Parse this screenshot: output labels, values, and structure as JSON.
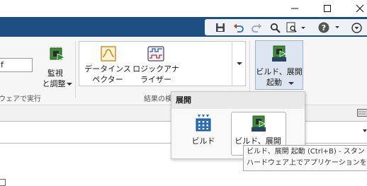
{
  "window": {
    "minimize_icon": "minimize-icon",
    "maximize_icon": "maximize-icon",
    "close_icon": "close-icon"
  },
  "quick_access": {
    "icons": [
      "save-icon",
      "undo-icon",
      "redo-icon",
      "search-icon",
      "search-docs-icon",
      "help-icon",
      "minimize-ribbon-icon"
    ]
  },
  "ribbon": {
    "field_value": "f",
    "monitor_label_line1": "監視",
    "monitor_label_line2": "と調整",
    "run_group_label": "ウェアで実行",
    "gallery": {
      "items": [
        {
          "line1": "データインス",
          "line2": "ペクター"
        },
        {
          "line1": "ロジックアナ",
          "line2": "ライザー"
        }
      ],
      "group_label": "結果の検"
    },
    "build_deploy": {
      "line1": "ビルド、展開",
      "line2": "起動"
    }
  },
  "dropdown": {
    "header": "展開",
    "items": [
      {
        "label": "ビルド"
      },
      {
        "label": "ビルド、展開"
      }
    ]
  },
  "tooltip": {
    "line1": "ビルド、展開 起動 (Ctrl+B) - スタン",
    "line2": "ハードウェア上でアプリケーションを起動"
  },
  "colors": {
    "accent_bar": "#1e4f83",
    "ribbon_bg": "#f6f6f6",
    "build_button_bg": "#dde6f0",
    "help_icon": "#555555"
  }
}
